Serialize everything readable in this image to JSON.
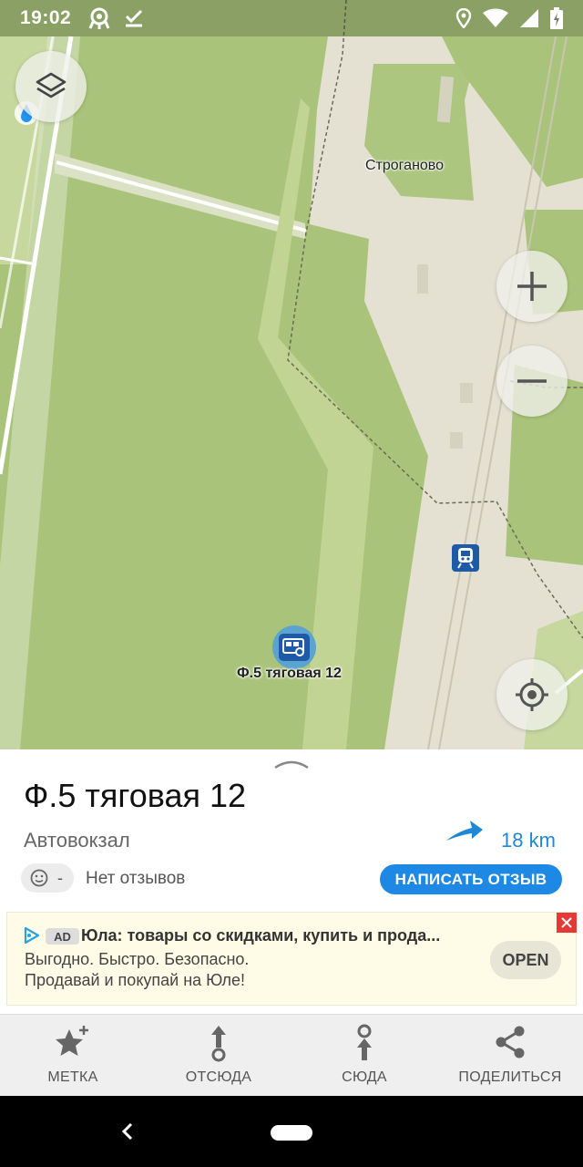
{
  "status_bar": {
    "time": "19:02",
    "icons_left": [
      "airplane-badge-icon",
      "check-download-icon"
    ],
    "icons_right": [
      "location-icon",
      "wifi-icon",
      "signal-icon",
      "battery-charging-icon"
    ]
  },
  "map": {
    "labels": {
      "village": "Строганово",
      "poi": "Ф.5 тяговая 12"
    },
    "controls": {
      "layers": "layers-icon",
      "zoom_in": "+",
      "zoom_out": "−",
      "my_location": "locate-icon"
    },
    "markers": [
      "bus-station-icon",
      "train-station-icon"
    ]
  },
  "place": {
    "title": "Ф.5 тяговая 12",
    "type": "Автовокзал",
    "distance": "18 km",
    "rating": "-",
    "reviews": "Нет отзывов",
    "write_review": "НАПИСАТЬ ОТЗЫВ"
  },
  "ad": {
    "badge": "AD",
    "title": "Юла: товары со скидками, купить и прода...",
    "line1": "Выгодно. Быстро. Безопасно.",
    "line2": "Продавай и покупай на Юле!",
    "cta": "OPEN"
  },
  "actions": [
    {
      "label": "МЕТКА",
      "icon": "star-add-icon"
    },
    {
      "label": "ОТСЮДА",
      "icon": "route-from-icon"
    },
    {
      "label": "СЮДА",
      "icon": "route-to-icon"
    },
    {
      "label": "ПОДЕЛИТЬСЯ",
      "icon": "share-icon"
    }
  ],
  "colors": {
    "accent": "#1e88e5",
    "map_green": "#a9c47a",
    "road": "#e6e3d4",
    "ad_close": "#e53935"
  }
}
